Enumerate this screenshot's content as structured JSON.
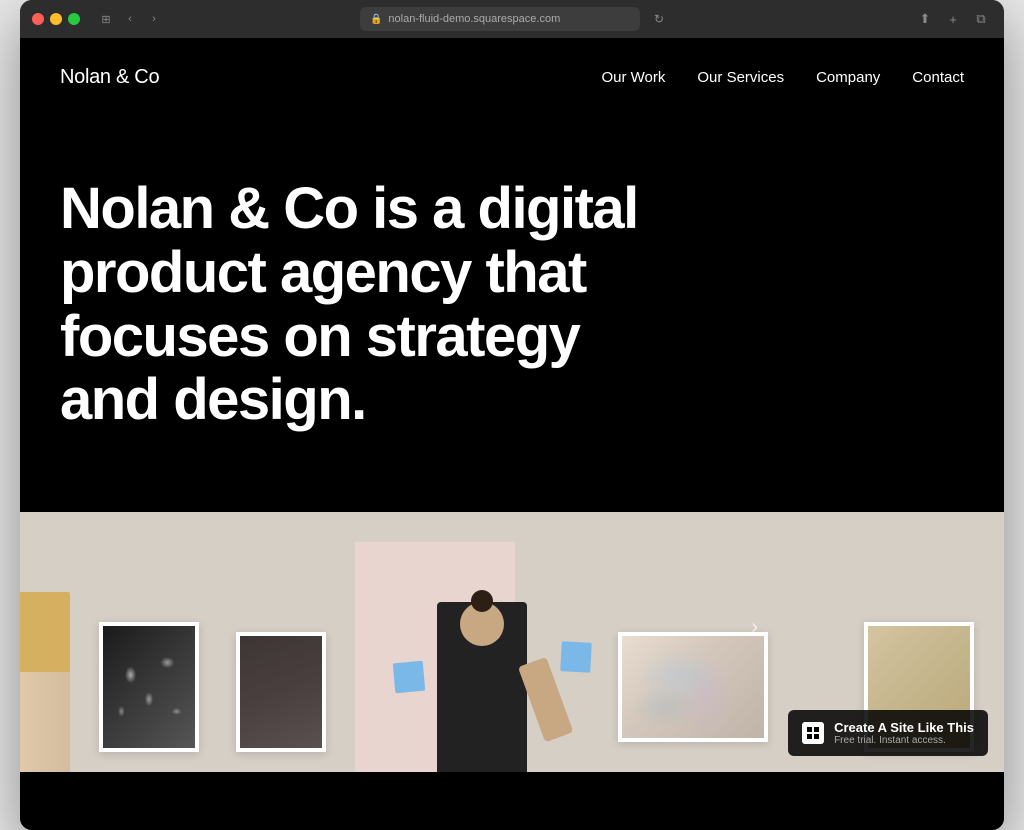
{
  "window": {
    "url": "nolan-fluid-demo.squarespace.com"
  },
  "site": {
    "logo": "Nolan & Co",
    "nav": {
      "items": [
        {
          "label": "Our Work",
          "id": "our-work"
        },
        {
          "label": "Our Services",
          "id": "our-services"
        },
        {
          "label": "Company",
          "id": "company"
        },
        {
          "label": "Contact",
          "id": "contact"
        }
      ]
    },
    "hero": {
      "text": "Nolan & Co is a digital product agency that focuses on strategy and design."
    },
    "badge": {
      "title": "Create A Site Like This",
      "subtitle": "Free trial. Instant access.",
      "logo_symbol": "◼"
    }
  }
}
